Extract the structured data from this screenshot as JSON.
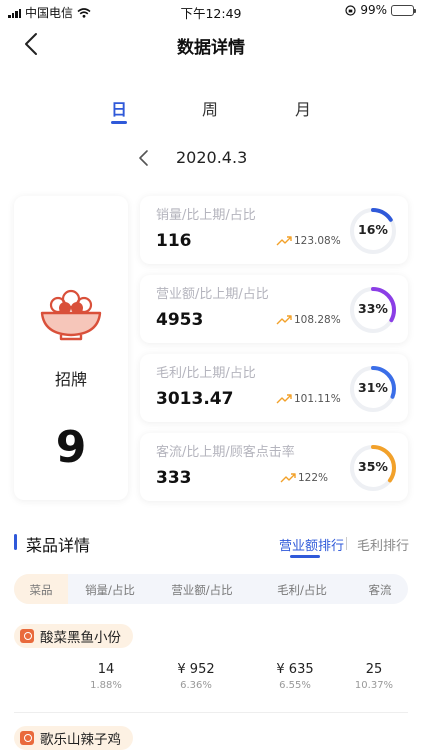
{
  "status_bar": {
    "carrier": "中国电信",
    "time": "下午12:49",
    "battery": "99%"
  },
  "header": {
    "title": "数据详情"
  },
  "period_tabs": [
    {
      "label": "日",
      "active": true
    },
    {
      "label": "周",
      "active": false
    },
    {
      "label": "月",
      "active": false
    }
  ],
  "date": "2020.4.3",
  "signature": {
    "label": "招牌",
    "count": "9"
  },
  "metrics": [
    {
      "label": "销量/比上期/占比",
      "value": "116",
      "change": "123.08%",
      "percent": "16%",
      "fraction": 0.16,
      "color": "#2f59d9"
    },
    {
      "label": "营业额/比上期/占比",
      "value": "4953",
      "change": "108.28%",
      "percent": "33%",
      "fraction": 0.33,
      "color": "#8b3ee6"
    },
    {
      "label": "毛利/比上期/占比",
      "value": "3013.47",
      "change": "101.11%",
      "percent": "31%",
      "fraction": 0.31,
      "color": "#3b6ee8"
    },
    {
      "label": "客流/比上期/顾客点击率",
      "value": "333",
      "change": "122%",
      "percent": "35%",
      "fraction": 0.35,
      "color": "#f2a12a"
    }
  ],
  "dish_section": {
    "title": "菜品详情",
    "rank_tabs": [
      {
        "label": "营业额排行",
        "active": true
      },
      {
        "label": "毛利排行",
        "active": false
      }
    ],
    "columns": [
      "菜品",
      "销量/占比",
      "营业额/占比",
      "毛利/占比",
      "客流"
    ],
    "rows": [
      {
        "name": "酸菜黑鱼小份",
        "sales": "14",
        "sales_pct": "1.88%",
        "revenue": "¥ 952",
        "revenue_pct": "6.36%",
        "profit": "¥ 635",
        "profit_pct": "6.55%",
        "traffic": "25",
        "traffic_pct": "10.37%"
      },
      {
        "name": "歌乐山辣子鸡"
      }
    ]
  },
  "colors": {
    "accent": "#2f59d9",
    "trend_arrow": "#f2a12a",
    "bowl": "#d9503a"
  }
}
